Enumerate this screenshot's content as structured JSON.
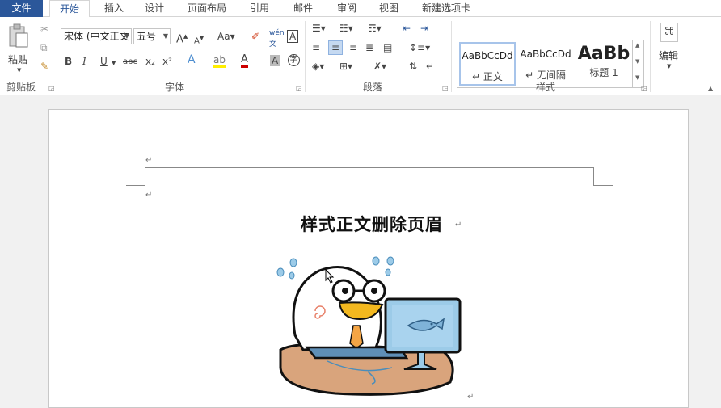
{
  "tabs": {
    "file": "文件",
    "items": [
      "开始",
      "插入",
      "设计",
      "页面布局",
      "引用",
      "邮件",
      "审阅",
      "视图",
      "新建选项卡"
    ]
  },
  "clipboard": {
    "paste": "粘贴",
    "group": "剪贴板"
  },
  "font": {
    "name": "宋体 (中文正文",
    "size": "五号",
    "group": "字体",
    "buttons": [
      "A",
      "A",
      "Aa",
      "B",
      "I",
      "U",
      "abc",
      "x₂",
      "x²",
      "A",
      "A",
      "A",
      "字"
    ]
  },
  "paragraph": {
    "group": "段落"
  },
  "styles": {
    "group": "样式",
    "items": [
      {
        "sample": "AaBbCcDd",
        "name": "↵ 正文"
      },
      {
        "sample": "AaBbCcDd",
        "name": "↵ 无间隔"
      },
      {
        "sample": "AaBb",
        "name": "标题 1"
      }
    ]
  },
  "editing": {
    "label": "编辑"
  },
  "document": {
    "title": "样式正文删除页眉",
    "para_mark": "↵"
  }
}
